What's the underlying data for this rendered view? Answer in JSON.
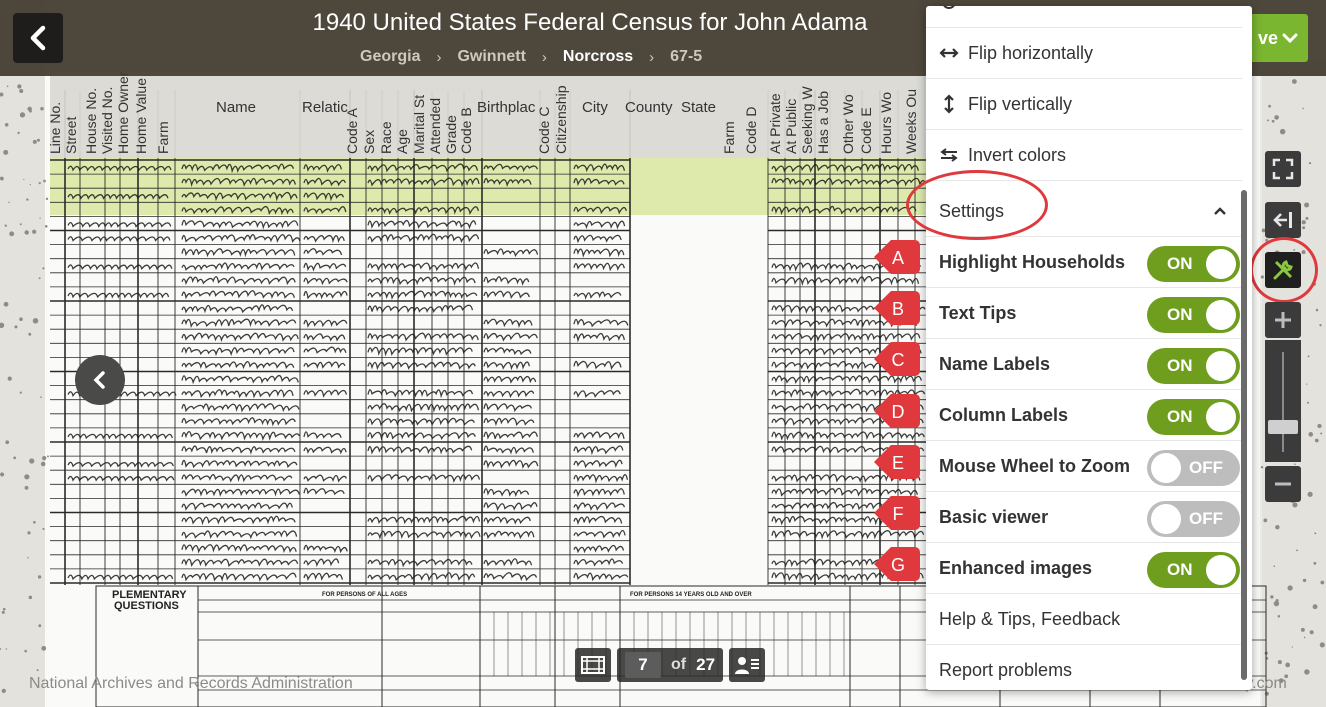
{
  "header": {
    "back_icon": "chevron-left-icon",
    "title": "1940 United States Federal Census for John Adama",
    "breadcrumb": [
      {
        "label": "Georgia",
        "current": false
      },
      {
        "label": "Gwinnett",
        "current": false
      },
      {
        "label": "Norcross",
        "current": true
      },
      {
        "label": "67-5",
        "current": false
      }
    ],
    "save_label": "ve",
    "save_icon": "chevron-down-icon",
    "save_color": "#7ab62f"
  },
  "census_columns": {
    "horizontal": [
      "Name",
      "Relatic",
      "Birthplac",
      "City",
      "County",
      "State"
    ],
    "vertical": [
      "Line No.",
      "Street",
      "House No.",
      "Visited No.",
      "Home Owner",
      "Home Value",
      "Farm",
      "Code A",
      "Sex",
      "Race",
      "Age",
      "Marital St",
      "Attended",
      "Grade",
      "Code B",
      "Code C",
      "Citizenship",
      "Farm",
      "Code D",
      "At Private",
      "At Public",
      "Seeking W",
      "Has a Job",
      "Other Wo",
      "Code E",
      "Hours Wo",
      "Weeks Ou"
    ]
  },
  "census_form": {
    "supplementary": [
      "PLEMENTARY",
      "QUESTIONS"
    ],
    "persons_all_ages": "FOR PERSONS OF ALL AGES",
    "persons_14": "FOR PERSONS 14 YEARS OLD AND OVER"
  },
  "menu": {
    "top_items": [
      {
        "icon": "flip-horizontal-icon",
        "label": "Flip horizontally"
      },
      {
        "icon": "flip-vertical-icon",
        "label": "Flip vertically"
      },
      {
        "icon": "invert-colors-icon",
        "label": "Invert colors"
      }
    ],
    "settings_header": "Settings",
    "settings_icon": "chevron-up-icon",
    "settings": [
      {
        "marker": "A",
        "label": "Highlight Households",
        "state": "ON"
      },
      {
        "marker": "B",
        "label": "Text Tips",
        "state": "ON"
      },
      {
        "marker": "C",
        "label": "Name Labels",
        "state": "ON"
      },
      {
        "marker": "D",
        "label": "Column Labels",
        "state": "ON"
      },
      {
        "marker": "E",
        "label": "Mouse Wheel to Zoom",
        "state": "OFF"
      },
      {
        "marker": "F",
        "label": "Basic viewer",
        "state": "OFF"
      },
      {
        "marker": "G",
        "label": "Enhanced images",
        "state": "ON"
      }
    ],
    "bottom_items": [
      {
        "label": "Help & Tips, Feedback"
      },
      {
        "label": "Report problems"
      }
    ]
  },
  "toolbar": {
    "buttons": [
      "fullscreen-icon",
      "close-panel-icon",
      "tools-icon",
      "zoom-in-icon",
      "zoom-out-icon"
    ],
    "zoom_level": 0.25
  },
  "pager": {
    "filmstrip_icon": "filmstrip-icon",
    "current_page": "7",
    "of_label": "of",
    "total_pages": "27",
    "index_icon": "person-index-icon"
  },
  "credits": {
    "left": "National Archives and Records Administration",
    "right": "ry.com"
  },
  "colors": {
    "toggle_on": "#6f9e1f",
    "toggle_off": "#bdbdbd",
    "marker_red": "#e0393d",
    "highlight_household": "#d9e8a4"
  }
}
